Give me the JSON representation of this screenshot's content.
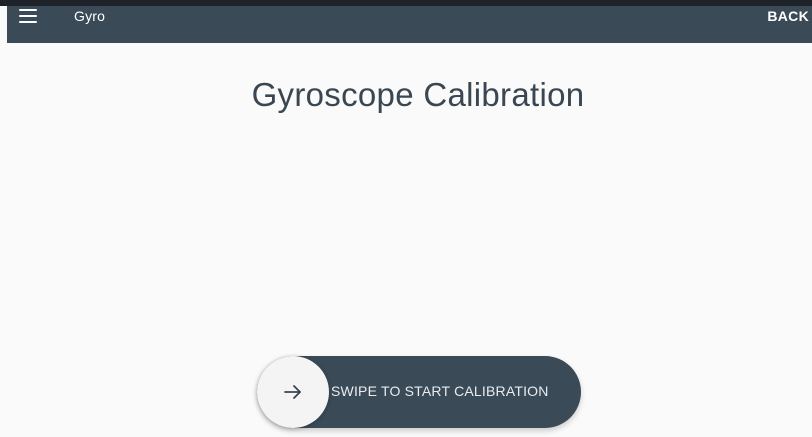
{
  "header": {
    "menu_icon": "hamburger-menu-icon",
    "title": "Gyro",
    "back_label": "BACK"
  },
  "main": {
    "title": "Gyroscope Calibration"
  },
  "swipe": {
    "icon": "arrow-right-icon",
    "label": "SWIPE TO START CALIBRATION"
  },
  "colors": {
    "primary": "#3a4a57",
    "background": "#fafafa",
    "knob": "#f4f4f4"
  }
}
